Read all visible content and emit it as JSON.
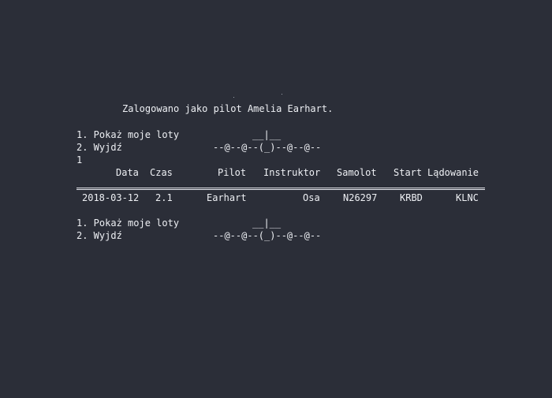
{
  "login_message": "Zalogowano jako pilot Amelia Earhart.",
  "menu": {
    "item1": "1. Pokaż moje loty",
    "item2": "2. Wyjdź",
    "art_top": "__|__",
    "art_bottom": "--@--@--(_)--@--@--"
  },
  "user_input": "1",
  "table": {
    "headers": {
      "data": "Data",
      "czas": "Czas",
      "pilot": "Pilot",
      "instruktor": "Instruktor",
      "samolot": "Samolot",
      "start": "Start",
      "ladowanie": "Lądowanie"
    },
    "rows": [
      {
        "data": "2018-03-12",
        "czas": "2.1",
        "pilot": "Earhart",
        "instruktor": "Osa",
        "samolot": "N26297",
        "start": "KRBD",
        "ladowanie": "KLNC"
      }
    ]
  },
  "menu2": {
    "item1": "1. Pokaż moje loty",
    "item2": "2. Wyjdź",
    "art_top": "__|__",
    "art_bottom": "--@--@--(_)--@--@--"
  }
}
